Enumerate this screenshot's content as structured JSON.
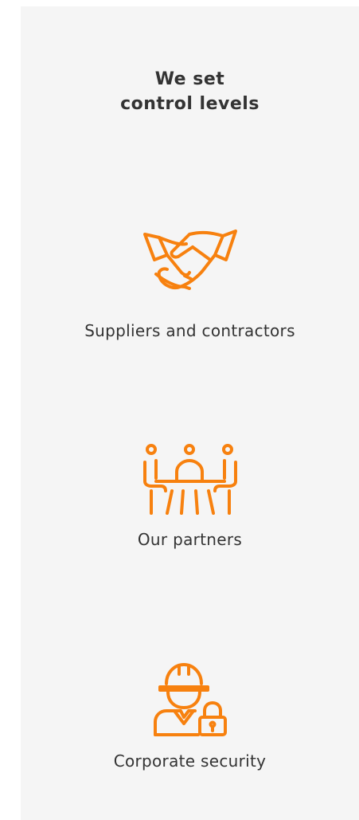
{
  "section": {
    "heading_line1": "We set",
    "heading_line2": "control levels"
  },
  "items": [
    {
      "label": "Suppliers and contractors",
      "icon": "handshake-icon"
    },
    {
      "label": "Our partners",
      "icon": "meeting-table-icon"
    },
    {
      "label": "Corporate security",
      "icon": "worker-lock-icon"
    }
  ],
  "colors": {
    "accent": "#f7810f",
    "text": "#333333",
    "card_background": "#f5f5f5",
    "page_background": "#ffffff"
  }
}
